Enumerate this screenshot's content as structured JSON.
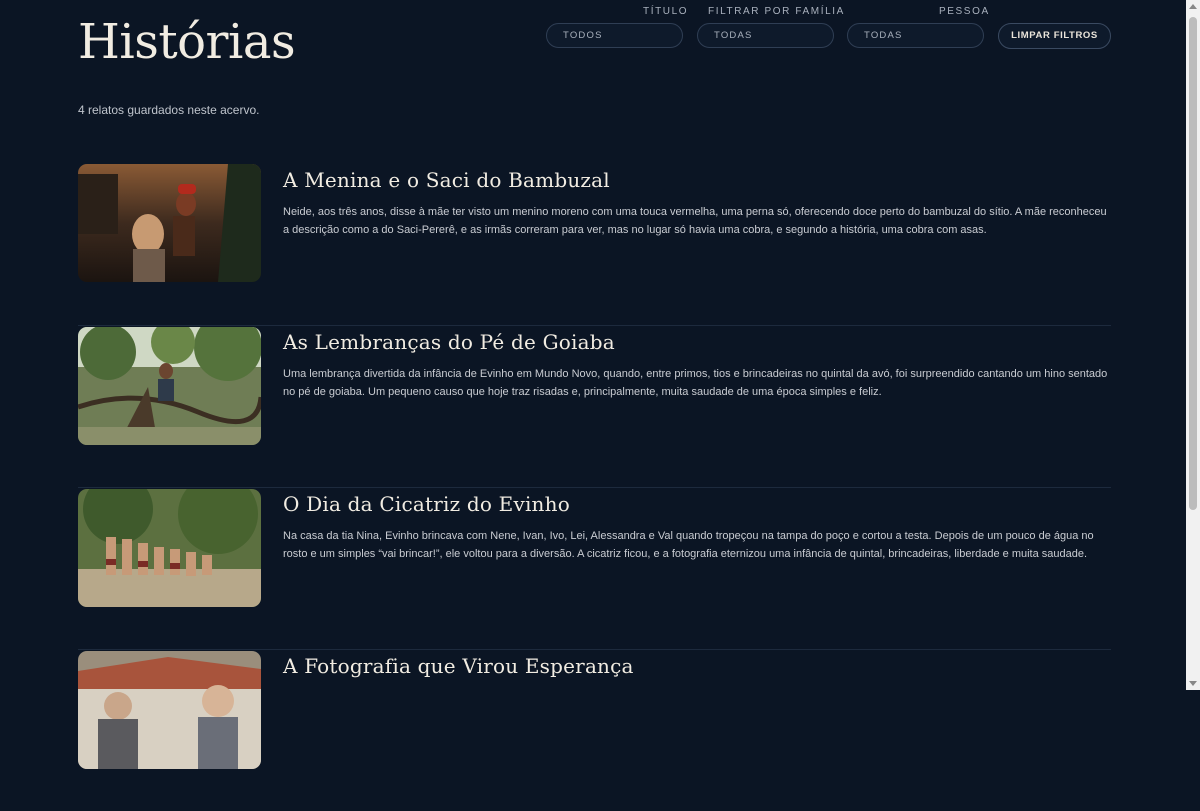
{
  "header": {
    "title": "Histórias"
  },
  "filters": {
    "titulo": {
      "label": "TÍTULO",
      "value": "TODOS"
    },
    "familia": {
      "label": "FILTRAR POR FAMÍLIA",
      "value": "TODAS"
    },
    "pessoa": {
      "label": "PESSOA",
      "value": "TODAS"
    },
    "clear_label": "LIMPAR FILTROS"
  },
  "summary": "4 relatos guardados neste acervo.",
  "stories": [
    {
      "title": "A Menina e o Saci do Bambuzal",
      "text": "Neide, aos três anos, disse à mãe ter visto um menino moreno com uma touca vermelha, uma perna só, oferecendo doce perto do bambuzal do sítio. A mãe reconheceu a descrição como a do Saci-Pererê, e as irmãs correram para ver, mas no lugar só havia uma cobra, e segundo a história, uma cobra com asas."
    },
    {
      "title": "As Lembranças do Pé de Goiaba",
      "text": "Uma lembrança divertida da infância de Evinho em Mundo Novo, quando, entre primos, tios e brincadeiras no quintal da avó, foi surpreendido cantando um hino sentado no pé de goiaba. Um pequeno causo que hoje traz risadas e, principalmente, muita saudade de uma época simples e feliz."
    },
    {
      "title": "O Dia da Cicatriz do Evinho",
      "text": "Na casa da tia Nina, Evinho brincava com Nene, Ivan, Ivo, Lei, Alessandra e Val quando tropeçou na tampa do poço e cortou a testa. Depois de um pouco de água no rosto e um simples “vai brincar!”, ele voltou para a diversão. A cicatriz ficou, e a fotografia eternizou uma infância de quintal, brincadeiras, liberdade e muita saudade."
    },
    {
      "title": "A Fotografia que Virou Esperança",
      "text": ""
    }
  ],
  "colors": {
    "background": "#0b1524",
    "divider": "#1d2a3d",
    "border": "#2f3e54"
  }
}
